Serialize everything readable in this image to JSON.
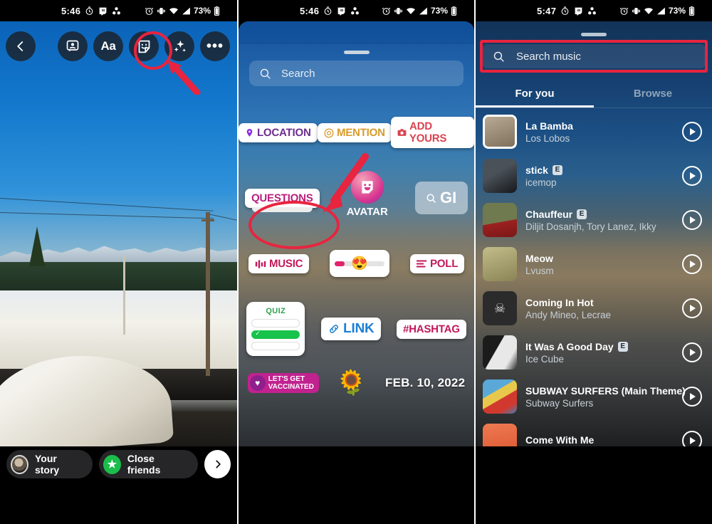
{
  "panel1": {
    "status_bar": {
      "time": "5:46",
      "left_icons": [
        "alarm-timer-icon",
        "twitch-icon",
        "clubhouse-icon"
      ],
      "right_icons": [
        "alarm-icon",
        "vibrate-icon",
        "wifi-icon",
        "signal-icon"
      ],
      "battery_text": "73%",
      "battery_icon": "battery-icon"
    },
    "topbar": {
      "back_icon": "chevron-left-icon",
      "buttons": [
        {
          "name": "add-photo-sticker-button",
          "icon": "photo-person-icon"
        },
        {
          "name": "text-tool-button",
          "icon": "text-aa-icon",
          "label": "Aa"
        },
        {
          "name": "sticker-tool-button",
          "icon": "sticker-smiley-icon",
          "highlighted": true
        },
        {
          "name": "effects-button",
          "icon": "sparkles-icon"
        },
        {
          "name": "more-options-button",
          "icon": "three-dots-icon",
          "label": "•••"
        }
      ]
    },
    "bottombar": {
      "your_story_label": "Your story",
      "close_friends_label": "Close friends",
      "next_icon": "chevron-right-icon"
    },
    "annotation": {
      "highlight_color": "#e8243f",
      "arrow": "red-arrow-pointing-up-left"
    }
  },
  "panel2": {
    "status_bar": {
      "time": "5:46",
      "battery_text": "73%"
    },
    "search": {
      "placeholder": "Search",
      "icon": "search-icon"
    },
    "stickers": [
      [
        {
          "name": "location-sticker",
          "label": "LOCATION",
          "icon": "pin-icon",
          "color": "#6b2d8f"
        },
        {
          "name": "mention-sticker",
          "label": "MENTION",
          "icon": "at-icon",
          "color": "#d79b2b"
        },
        {
          "name": "add-yours-sticker",
          "label": "ADD YOURS",
          "icon": "camera-icon",
          "color": "#d94452"
        }
      ],
      [
        {
          "name": "questions-sticker",
          "label": "QUESTIONS",
          "color": "#b81f7d"
        },
        {
          "name": "avatar-sticker",
          "label": "AVATAR",
          "icon": "avatar-face-icon"
        },
        {
          "name": "gif-sticker",
          "label": "GI",
          "icon": "search-icon"
        }
      ],
      [
        {
          "name": "music-sticker",
          "label": "MUSIC",
          "icon": "music-bars-icon",
          "color": "#c2185b",
          "highlighted": true
        },
        {
          "name": "emoji-slider-sticker",
          "label": "",
          "icon": "heart-eyes-emoji"
        },
        {
          "name": "poll-sticker",
          "label": "POLL",
          "icon": "poll-lines-icon",
          "color": "#c2185b"
        }
      ],
      [
        {
          "name": "quiz-sticker",
          "label": "QUIZ",
          "color": "#2e9e4f"
        },
        {
          "name": "link-sticker",
          "label": "LINK",
          "icon": "link-chain-icon",
          "color": "#1d7fd4"
        },
        {
          "name": "hashtag-sticker",
          "label": "#HASHTAG",
          "color": "#c2185b"
        }
      ],
      [
        {
          "name": "vaccinated-sticker",
          "label_line1": "LET'S GET",
          "label_line2": "VACCINATED",
          "icon": "heart-shield-icon"
        },
        {
          "name": "bandaid-flower-sticker",
          "icon": "bandaid-flower-icon"
        },
        {
          "name": "date-sticker",
          "label": "FEB. 10, 2022"
        }
      ]
    ],
    "annotation": {
      "highlight_color": "#e8243f",
      "arrow": "red-arrow-pointing-down-left"
    }
  },
  "panel3": {
    "status_bar": {
      "time": "5:47",
      "battery_text": "73%"
    },
    "search": {
      "placeholder": "Search music",
      "icon": "search-icon",
      "highlighted": true
    },
    "tabs": [
      {
        "name": "tab-for-you",
        "label": "For you",
        "active": true
      },
      {
        "name": "tab-browse",
        "label": "Browse",
        "active": false
      }
    ],
    "tracks": [
      {
        "title": "La Bamba",
        "artist": "Los Lobos",
        "explicit": false,
        "art": "bench-photo",
        "selected": true
      },
      {
        "title": "stick",
        "artist": "icemop",
        "explicit": true,
        "art": "black-cat-photo",
        "selected": false
      },
      {
        "title": "Chauffeur",
        "artist": "Diljit Dosanjh, Tory Lanez, Ikky",
        "explicit": true,
        "art": "chauffeur-cover",
        "selected": false
      },
      {
        "title": "Meow",
        "artist": "Lvusm",
        "explicit": false,
        "art": "cat-photo",
        "selected": false
      },
      {
        "title": "Coming In Hot",
        "artist": "Andy Mineo, Lecrae",
        "explicit": false,
        "art": "skull-cover",
        "selected": false
      },
      {
        "title": "It Was A Good Day",
        "artist": "Ice Cube",
        "explicit": true,
        "art": "ice-cube-cover",
        "selected": false
      },
      {
        "title": "SUBWAY SURFERS  (Main Theme)",
        "artist": "Subway Surfers",
        "explicit": false,
        "art": "subway-surfers-cover",
        "selected": false
      },
      {
        "title": "Come With Me",
        "artist": "",
        "explicit": false,
        "art": "orange-cover",
        "selected": false
      }
    ],
    "play_icon": "play-circle-icon",
    "explicit_badge": "E",
    "annotation": {
      "highlight_color": "#e8243f"
    }
  }
}
